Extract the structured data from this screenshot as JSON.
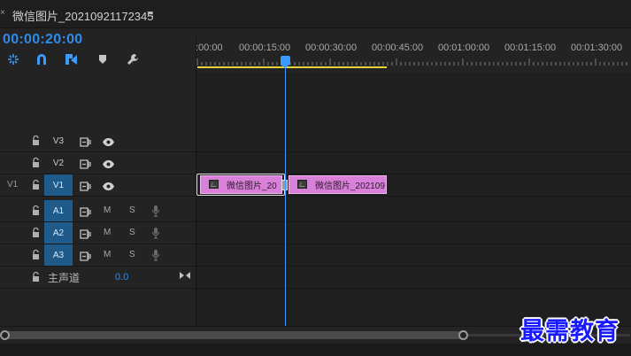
{
  "window": {
    "close_glyph": "×",
    "sequence_title": "微信图片_20210921172345",
    "menu_glyph": "≡"
  },
  "timecode": "00:00:20:00",
  "toolbar": {
    "tools": [
      "nest-icon",
      "snap-icon",
      "linked-selection-icon",
      "marker-icon",
      "wrench-icon"
    ]
  },
  "ruler": {
    "labels": [
      ":00:00",
      "00:00:15:00",
      "00:00:30:00",
      "00:00:45:00",
      "00:01:00:00",
      "00:01:15:00",
      "00:01:30:00"
    ]
  },
  "tracks": {
    "video": [
      {
        "name": "V3",
        "source": ""
      },
      {
        "name": "V2",
        "source": ""
      },
      {
        "name": "V1",
        "source": "V1"
      }
    ],
    "audio": [
      {
        "name": "A1",
        "mute": "M",
        "solo": "S"
      },
      {
        "name": "A2",
        "mute": "M",
        "solo": "S"
      },
      {
        "name": "A3",
        "mute": "M",
        "solo": "S"
      }
    ],
    "master": {
      "label": "主声道",
      "value": "0.0"
    }
  },
  "clips": [
    {
      "name": "微信图片_20"
    },
    {
      "name": "微信图片_202109"
    }
  ],
  "colors": {
    "accent": "#2d8ceb",
    "clip": "#d980d9",
    "work_area": "#e8d33a",
    "playhead": "#3a9bff",
    "track_active": "#1e5a8a"
  },
  "watermark": "最需教育"
}
